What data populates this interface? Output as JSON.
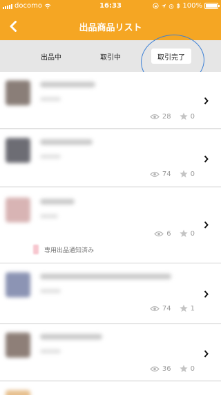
{
  "status_bar": {
    "carrier": "docomo",
    "time": "16:33",
    "battery": "100%",
    "battery_level": 1.0
  },
  "header": {
    "title": "出品商品リスト",
    "back_icon": "chevron-left-icon"
  },
  "tabs": [
    {
      "label": "出品中",
      "selected": false
    },
    {
      "label": "取引中",
      "selected": false
    },
    {
      "label": "取引完了",
      "selected": true
    }
  ],
  "items": [
    {
      "views": "28",
      "likes": "0"
    },
    {
      "views": "74",
      "likes": "0"
    },
    {
      "views": "6",
      "likes": "0",
      "notice": "専用出品通知済み"
    },
    {
      "views": "74",
      "likes": "1"
    },
    {
      "views": "36",
      "likes": "0"
    }
  ],
  "colors": {
    "header_bg": "#f5a623",
    "annotation_circle": "#3a7fd6"
  }
}
